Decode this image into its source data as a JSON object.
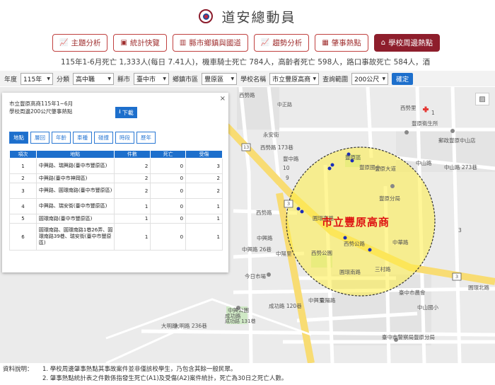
{
  "header": {
    "title": "道安總動員"
  },
  "nav": [
    {
      "label": "主題分析",
      "icon": "line-chart-icon",
      "active": false
    },
    {
      "label": "統計快覽",
      "icon": "gauge-icon",
      "active": false
    },
    {
      "label": "縣市鄉鎮與國道",
      "icon": "bar-chart-icon",
      "active": false
    },
    {
      "label": "趨勢分析",
      "icon": "line-chart-icon",
      "active": false
    },
    {
      "label": "肇事熱點",
      "icon": "map-pin-icon",
      "active": false
    },
    {
      "label": "學校周邊熱點",
      "icon": "school-icon",
      "active": true
    }
  ],
  "ticker": "115年1-6月死亡 1,333人(每日 7.41人)，機車騎士死亡 784人，高齡者死亡 598人，路口事故死亡 584人，酒",
  "filters": {
    "year_label": "年度",
    "year_value": "115年",
    "class_label": "分類",
    "class_value": "高中職",
    "city_label": "縣市",
    "city_value": "臺中市",
    "district_label": "鄉鎮市區",
    "district_value": "豐原區",
    "school_label": "學校名稱",
    "school_value": "市立豐原高商",
    "range_label": "查詢範圍",
    "range_value": "200公尺",
    "confirm_label": "確定"
  },
  "map": {
    "school_label": "市立豐原高商",
    "labels": [
      "西勢路",
      "中正路",
      "永安街",
      "中山路",
      "中山路 273巷",
      "豐原分局",
      "豐原國小",
      "西勢路",
      "西勢路 173巷",
      "豐原大道",
      "豐中路",
      "中興路",
      "中興路 26巷",
      "圓環東路",
      "圓環北路",
      "圓環南路",
      "東陽路",
      "三村路",
      "中華路",
      "成功路",
      "成功路 120巷",
      "成功路 131巷",
      "大明路",
      "大明路 236巷",
      "今日市場",
      "豐原衛生所",
      "郵政豐原中山店",
      "西勢公園",
      "臺中市農會",
      "中興公園",
      "臺中市警察局豐原分局",
      "豐原區",
      "西勢里",
      "西勢公路",
      "中興里",
      "中陽里",
      "中山國小",
      "13",
      "3",
      "3",
      "3",
      "10",
      "9",
      "1"
    ]
  },
  "panel": {
    "line1": "市立豐原高商115年1~6月",
    "line2": "學校周邊200公尺肇事熱點",
    "download_label": "下載",
    "close": "×",
    "tabs": [
      "地點",
      "層回",
      "年齡",
      "車種",
      "碰撞",
      "時段",
      "歷年"
    ],
    "columns": [
      "項次",
      "地點",
      "件數",
      "死亡",
      "受傷"
    ],
    "rows": [
      {
        "no": "1",
        "loc": "中興路、瑞興路(臺中市豐原區)",
        "count": "2",
        "death": "0",
        "injury": "3"
      },
      {
        "no": "2",
        "loc": "中興路(臺中市神岡區)",
        "count": "2",
        "death": "0",
        "injury": "2"
      },
      {
        "no": "3",
        "loc": "中興路、圓環南路(臺中市豐原區)",
        "count": "2",
        "death": "0",
        "injury": "2"
      },
      {
        "no": "4",
        "loc": "中興路、瑞安街(臺中市豐原區)",
        "count": "1",
        "death": "0",
        "injury": "1"
      },
      {
        "no": "5",
        "loc": "圓環南路(臺中市豐原區)",
        "count": "1",
        "death": "0",
        "injury": "1"
      },
      {
        "no": "6",
        "loc": "圓環南路、圓環南路1巷26弄、圓環南路39巷、瑞安街(臺中市豐原區)",
        "count": "1",
        "death": "0",
        "injury": "1"
      }
    ]
  },
  "notes": {
    "label": "資料說明：",
    "n1": "1. 學校周邊肇事熱點其事故案件並非僅該校學生，乃包含其餘一般民眾。",
    "n2": "2. 肇事熱點統計表之件數係指發生死亡(A1)及受傷(A2)案件統計，死亡為30日之死亡人數。"
  },
  "colors": {
    "brand": "#8e1e2c",
    "accent": "#1d6fcc",
    "highlight": "#ffee44"
  }
}
